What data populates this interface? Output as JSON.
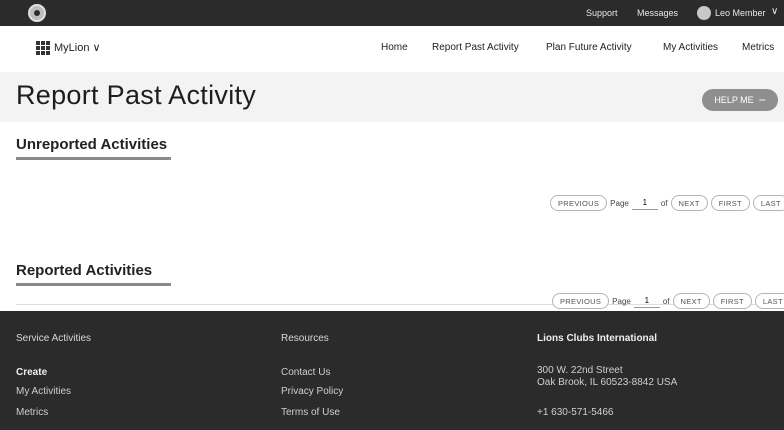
{
  "topbar": {
    "support": "Support",
    "messages": "Messages",
    "user": "Leo Member",
    "caret": "∨"
  },
  "mainnav": {
    "app_name": "MyLion ∨",
    "links": [
      "Home",
      "Report Past Activity",
      "Plan Future Activity",
      "My Activities",
      "Metrics"
    ]
  },
  "page": {
    "title": "Report Past Activity",
    "help_label": "HELP ME"
  },
  "unreported": {
    "heading": "Unreported Activities",
    "pager": {
      "previous": "PREVIOUS",
      "page_label": "Page",
      "page_value": "1",
      "of_label": "of",
      "next": "NEXT",
      "first": "FIRST",
      "last": "LAST"
    }
  },
  "reported": {
    "heading": "Reported Activities",
    "pager": {
      "previous": "PREVIOUS",
      "page_label": "Page",
      "page_value": "1",
      "of_label": "of",
      "next": "NEXT",
      "first": "FIRST",
      "last": "LAST"
    }
  },
  "footer": {
    "col1": {
      "heading": "Service Activities",
      "items": [
        "Create",
        "My Activities",
        "Metrics"
      ]
    },
    "col2": {
      "heading": "Resources",
      "items": [
        "Contact Us",
        "Privacy Policy",
        "Terms of Use"
      ]
    },
    "col3": {
      "heading": "Lions Clubs International",
      "address_line1": "300 W. 22nd Street",
      "address_line2": "Oak Brook, IL 60523-8842 USA",
      "phone": "+1 630-571-5466"
    }
  },
  "colors": {
    "topbar_bg": "#2b2b2b",
    "title_band_bg": "#f3f3f3",
    "footer_bg": "#2b2b2b",
    "help_button_bg": "#8f8f8f"
  },
  "icons": {
    "logo": "lions-logo-icon",
    "apps": "grid-apps-icon",
    "avatar": "user-avatar-icon"
  }
}
